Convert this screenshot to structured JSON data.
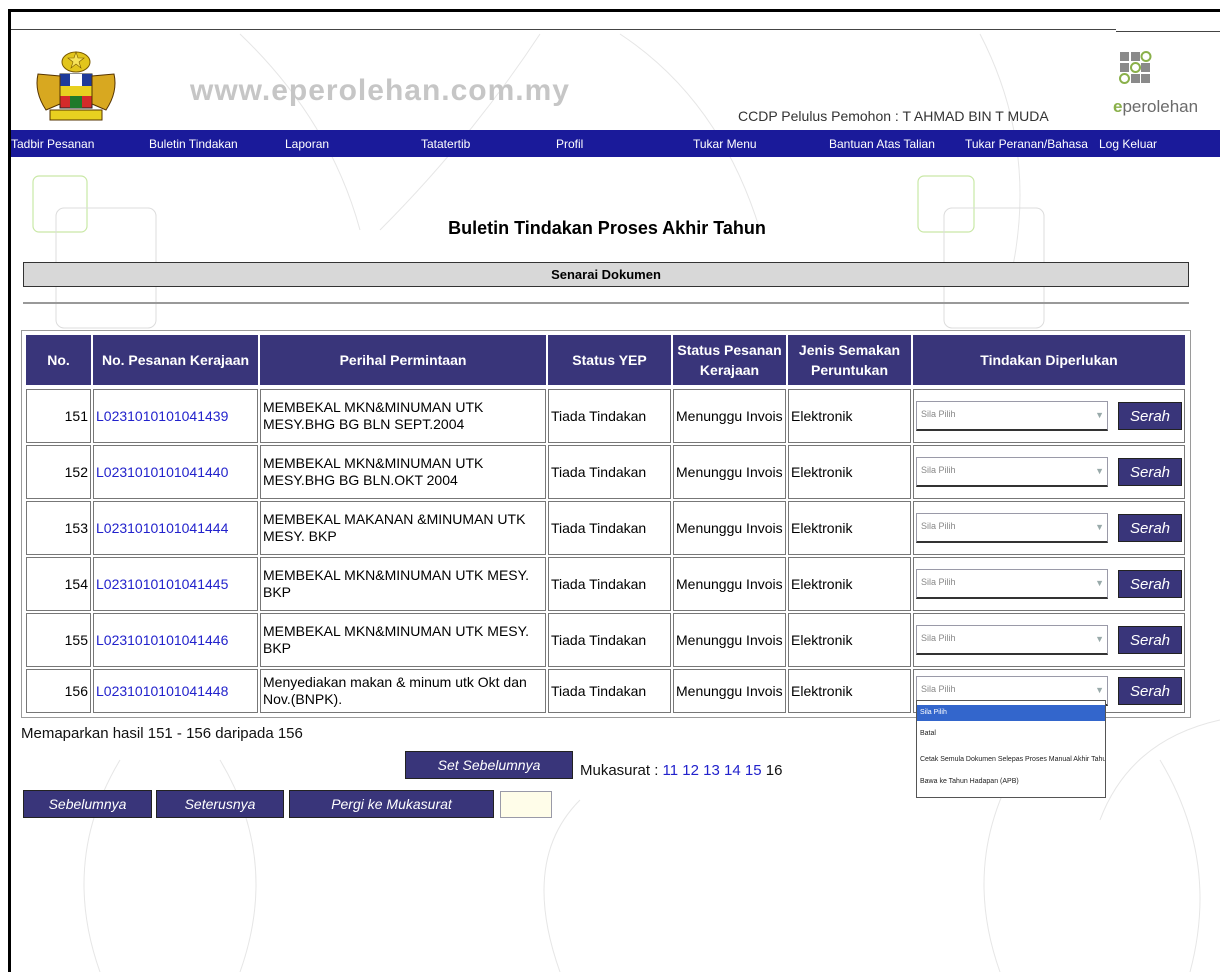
{
  "header": {
    "site_url": "www.eperolehan.com.my",
    "user_info": "CCDP Pelulus Pemohon : T AHMAD BIN T MUDA",
    "brand_e": "e",
    "brand_rest": "perolehan"
  },
  "nav": {
    "items": [
      "Tadbir Pesanan",
      "Buletin Tindakan",
      "Laporan",
      "Tatatertib",
      "Profil",
      "Tukar Menu",
      "Bantuan Atas Talian",
      "Tukar Peranan/Bahasa",
      "Log Keluar"
    ]
  },
  "page": {
    "title": "Buletin Tindakan Proses Akhir Tahun",
    "section": "Senarai Dokumen"
  },
  "table": {
    "headers": {
      "no": "No.",
      "pesanan": "No. Pesanan Kerajaan",
      "perihal": "Perihal Permintaan",
      "status_yep": "Status YEP",
      "status_pesanan": "Status Pesanan Kerajaan",
      "jenis": "Jenis Semakan Peruntukan",
      "tindakan": "Tindakan Diperlukan"
    },
    "rows": [
      {
        "no": "151",
        "pesanan": "L0231010101041439",
        "perihal": "MEMBEKAL MKN&MINUMAN UTK MESY.BHG BG BLN SEPT.2004",
        "status_yep": "Tiada Tindakan",
        "status_pesanan": "Menunggu Invois",
        "jenis": "Elektronik",
        "select": "Sila Pilih",
        "action": "Serah"
      },
      {
        "no": "152",
        "pesanan": "L0231010101041440",
        "perihal": "MEMBEKAL MKN&MINUMAN UTK MESY.BHG BG BLN.OKT 2004",
        "status_yep": "Tiada Tindakan",
        "status_pesanan": "Menunggu Invois",
        "jenis": "Elektronik",
        "select": "Sila Pilih",
        "action": "Serah"
      },
      {
        "no": "153",
        "pesanan": "L0231010101041444",
        "perihal": "MEMBEKAL MAKANAN &MINUMAN UTK MESY. BKP",
        "status_yep": "Tiada Tindakan",
        "status_pesanan": "Menunggu Invois",
        "jenis": "Elektronik",
        "select": "Sila Pilih",
        "action": "Serah"
      },
      {
        "no": "154",
        "pesanan": "L0231010101041445",
        "perihal": "MEMBEKAL MKN&MINUMAN UTK MESY. BKP",
        "status_yep": "Tiada Tindakan",
        "status_pesanan": "Menunggu Invois",
        "jenis": "Elektronik",
        "select": "Sila Pilih",
        "action": "Serah"
      },
      {
        "no": "155",
        "pesanan": "L0231010101041446",
        "perihal": "MEMBEKAL MKN&MINUMAN UTK MESY. BKP",
        "status_yep": "Tiada Tindakan",
        "status_pesanan": "Menunggu Invois",
        "jenis": "Elektronik",
        "select": "Sila Pilih",
        "action": "Serah"
      },
      {
        "no": "156",
        "pesanan": "L0231010101041448",
        "perihal": "Menyediakan makan & minum utk Okt dan Nov.(BNPK).",
        "status_yep": "Tiada Tindakan",
        "status_pesanan": "Menunggu Invois",
        "jenis": "Elektronik",
        "select": "Sila Pilih",
        "action": "Serah"
      }
    ]
  },
  "dropdown": {
    "options": [
      "Sila Pilih",
      "Batal",
      "Cetak Semula Dokumen Selepas Proses Manual Akhir Tahun",
      "Bawa ke Tahun Hadapan (APB)"
    ]
  },
  "footer": {
    "result_text": "Memaparkan hasil 151 - 156 daripada 156",
    "set_prev": "Set Sebelumnya",
    "mukasurat_label": "Mukasurat :",
    "pages": [
      "11",
      "12",
      "13",
      "14",
      "15"
    ],
    "current_page": "16",
    "prev": "Sebelumnya",
    "next": "Seterusnya",
    "goto": "Pergi ke Mukasurat",
    "goto_value": ""
  },
  "colors": {
    "nav_bg": "#1a1a9a",
    "header_bg": "#39357a",
    "link": "#2222cc",
    "selected_option": "#3366cc"
  }
}
